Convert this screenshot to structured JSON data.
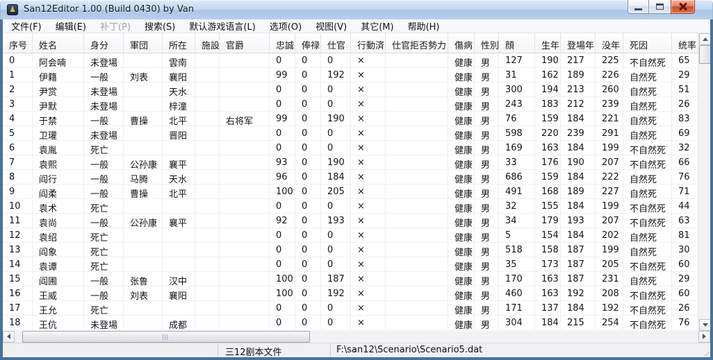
{
  "window": {
    "title": "San12Editor 1.00 (Build 0430) by Van"
  },
  "menu": {
    "items": [
      {
        "id": "file",
        "label": "文件(F)",
        "enabled": true
      },
      {
        "id": "edit",
        "label": "编辑(E)",
        "enabled": true
      },
      {
        "id": "patch",
        "label": "补丁(P)",
        "enabled": false
      },
      {
        "id": "search",
        "label": "搜索(S)",
        "enabled": true
      },
      {
        "id": "default-game-language",
        "label": "默认游戏语言(L)",
        "enabled": true
      },
      {
        "id": "options",
        "label": "选项(O)",
        "enabled": true
      },
      {
        "id": "view",
        "label": "视图(V)",
        "enabled": true
      },
      {
        "id": "misc",
        "label": "其它(M)",
        "enabled": true
      },
      {
        "id": "help",
        "label": "帮助(H)",
        "enabled": true
      }
    ]
  },
  "table": {
    "column_ids": [
      "index",
      "name",
      "status",
      "faction",
      "location",
      "facility",
      "title",
      "loyalty",
      "salary",
      "service-year",
      "acted",
      "refuse-force",
      "health",
      "gender",
      "face",
      "birth-year",
      "debut-year",
      "death-year",
      "death-cause",
      "leadership"
    ],
    "columns": [
      "序号",
      "姓名",
      "身分",
      "軍団",
      "所在",
      "施設",
      "官爵",
      "忠誠",
      "俸禄",
      "仕官",
      "行動済",
      "仕官拒否勢力",
      "傷病",
      "性別",
      "顔",
      "生年",
      "登場年",
      "没年",
      "死因",
      "统率"
    ],
    "rows": [
      [
        "0",
        "阿会喃",
        "未登場",
        "",
        "雲南",
        "",
        "",
        "0",
        "0",
        "0",
        "×",
        "",
        "健康",
        "男",
        "127",
        "190",
        "217",
        "225",
        "不自然死",
        "65"
      ],
      [
        "1",
        "伊籍",
        "一般",
        "刘表",
        "襄阳",
        "",
        "",
        "99",
        "0",
        "192",
        "×",
        "",
        "健康",
        "男",
        "31",
        "162",
        "189",
        "226",
        "自然死",
        "29"
      ],
      [
        "2",
        "尹赏",
        "未登場",
        "",
        "天水",
        "",
        "",
        "0",
        "0",
        "0",
        "×",
        "",
        "健康",
        "男",
        "300",
        "194",
        "213",
        "260",
        "自然死",
        "51"
      ],
      [
        "3",
        "尹默",
        "未登場",
        "",
        "梓潼",
        "",
        "",
        "0",
        "0",
        "0",
        "×",
        "",
        "健康",
        "男",
        "243",
        "183",
        "212",
        "239",
        "自然死",
        "26"
      ],
      [
        "4",
        "于禁",
        "一般",
        "曹操",
        "北平",
        "",
        "右将军",
        "99",
        "0",
        "190",
        "×",
        "",
        "健康",
        "男",
        "76",
        "159",
        "184",
        "221",
        "自然死",
        "83"
      ],
      [
        "5",
        "卫瓘",
        "未登場",
        "",
        "晋阳",
        "",
        "",
        "0",
        "0",
        "0",
        "×",
        "",
        "健康",
        "男",
        "598",
        "220",
        "239",
        "291",
        "自然死",
        "69"
      ],
      [
        "6",
        "袁胤",
        "死亡",
        "",
        "",
        "",
        "",
        "0",
        "0",
        "0",
        "×",
        "",
        "健康",
        "男",
        "169",
        "163",
        "184",
        "199",
        "不自然死",
        "32"
      ],
      [
        "7",
        "袁熙",
        "一般",
        "公孙康",
        "襄平",
        "",
        "",
        "93",
        "0",
        "190",
        "×",
        "",
        "健康",
        "男",
        "33",
        "176",
        "190",
        "207",
        "不自然死",
        "66"
      ],
      [
        "8",
        "阎行",
        "一般",
        "马腾",
        "天水",
        "",
        "",
        "96",
        "0",
        "184",
        "×",
        "",
        "健康",
        "男",
        "686",
        "159",
        "184",
        "222",
        "自然死",
        "76"
      ],
      [
        "9",
        "阎柔",
        "一般",
        "曹操",
        "北平",
        "",
        "",
        "100",
        "0",
        "205",
        "×",
        "",
        "健康",
        "男",
        "491",
        "168",
        "189",
        "227",
        "自然死",
        "71"
      ],
      [
        "10",
        "袁术",
        "死亡",
        "",
        "",
        "",
        "",
        "0",
        "0",
        "0",
        "×",
        "",
        "健康",
        "男",
        "32",
        "155",
        "184",
        "199",
        "不自然死",
        "44"
      ],
      [
        "11",
        "袁尚",
        "一般",
        "公孙康",
        "襄平",
        "",
        "",
        "92",
        "0",
        "193",
        "×",
        "",
        "健康",
        "男",
        "34",
        "179",
        "193",
        "207",
        "不自然死",
        "63"
      ],
      [
        "12",
        "袁绍",
        "死亡",
        "",
        "",
        "",
        "",
        "0",
        "0",
        "0",
        "×",
        "",
        "健康",
        "男",
        "5",
        "154",
        "184",
        "202",
        "自然死",
        "81"
      ],
      [
        "13",
        "阎象",
        "死亡",
        "",
        "",
        "",
        "",
        "0",
        "0",
        "0",
        "×",
        "",
        "健康",
        "男",
        "518",
        "158",
        "187",
        "199",
        "自然死",
        "30"
      ],
      [
        "14",
        "袁谭",
        "死亡",
        "",
        "",
        "",
        "",
        "0",
        "0",
        "0",
        "×",
        "",
        "健康",
        "男",
        "35",
        "173",
        "187",
        "205",
        "不自然死",
        "60"
      ],
      [
        "15",
        "阎圃",
        "一般",
        "张鲁",
        "汉中",
        "",
        "",
        "100",
        "0",
        "187",
        "×",
        "",
        "健康",
        "男",
        "170",
        "163",
        "187",
        "231",
        "自然死",
        "29"
      ],
      [
        "16",
        "王威",
        "一般",
        "刘表",
        "襄阳",
        "",
        "",
        "100",
        "0",
        "192",
        "×",
        "",
        "健康",
        "男",
        "460",
        "163",
        "192",
        "208",
        "不自然死",
        "60"
      ],
      [
        "17",
        "王允",
        "死亡",
        "",
        "",
        "",
        "",
        "0",
        "0",
        "0",
        "×",
        "",
        "健康",
        "男",
        "171",
        "137",
        "184",
        "192",
        "不自然死",
        "26"
      ],
      [
        "18",
        "王伉",
        "未登場",
        "",
        "成都",
        "",
        "",
        "0",
        "0",
        "0",
        "×",
        "",
        "健康",
        "男",
        "304",
        "184",
        "215",
        "254",
        "不自然死",
        "76"
      ]
    ]
  },
  "statusbar": {
    "file_type": "三12剧本文件",
    "file_path": "F:\\san12\\Scenario\\Scenario5.dat"
  },
  "icons": {
    "app_icon_glyph": "♟",
    "colors": {
      "titlebar": "#c4d8f0",
      "close_button": "#ce4f2c",
      "window_border": "#48719e"
    }
  }
}
